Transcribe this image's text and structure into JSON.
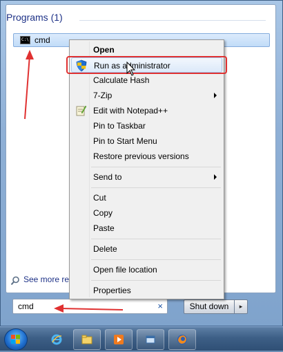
{
  "start_menu": {
    "programs_header": "Programs (1)",
    "program_item": {
      "label": "cmd",
      "icon": "cmd-icon"
    },
    "see_more_label": "See more res",
    "search": {
      "value": "cmd",
      "clear_glyph": "×"
    },
    "shutdown_label": "Shut down",
    "shutdown_arrow": "▸"
  },
  "context_menu": {
    "items": [
      {
        "label": "Open",
        "bold": true
      },
      {
        "label": "Run as administrator",
        "icon": "uac-shield-icon",
        "hover": true
      },
      {
        "label": "Calculate Hash"
      },
      {
        "label": "7-Zip",
        "submenu": true
      },
      {
        "label": "Edit with Notepad++",
        "icon": "notepad-plus-plus-icon"
      },
      {
        "label": "Pin to Taskbar"
      },
      {
        "label": "Pin to Start Menu"
      },
      {
        "label": "Restore previous versions"
      },
      {
        "label": "Send to",
        "submenu": true
      },
      {
        "label": "Cut"
      },
      {
        "label": "Copy"
      },
      {
        "label": "Paste"
      },
      {
        "label": "Delete"
      },
      {
        "label": "Open file location"
      },
      {
        "label": "Properties"
      }
    ]
  },
  "taskbar": {
    "items": [
      "start-orb-icon",
      "internet-explorer-icon",
      "file-explorer-icon",
      "media-player-icon",
      "window-app-icon",
      "firefox-icon"
    ]
  },
  "colors": {
    "annotation_red": "#e03131",
    "header_blue": "#1e3287"
  }
}
